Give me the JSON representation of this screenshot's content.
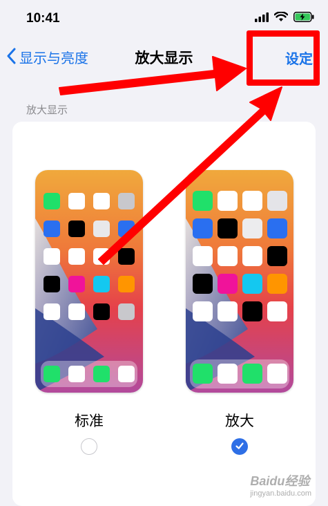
{
  "status_bar": {
    "time": "10:41"
  },
  "nav": {
    "back_label": "显示与亮度",
    "title": "放大显示",
    "action_label": "设定"
  },
  "section_header": "放大显示",
  "options": [
    {
      "label": "标准",
      "selected": false
    },
    {
      "label": "放大",
      "selected": true
    }
  ],
  "colors": {
    "accent": "#1a73e8",
    "annotation": "#ff0000",
    "radio_selected": "#2e6fe6"
  },
  "watermark": {
    "brand": "Baidu经验",
    "site": "jingyan.baidu.com"
  }
}
